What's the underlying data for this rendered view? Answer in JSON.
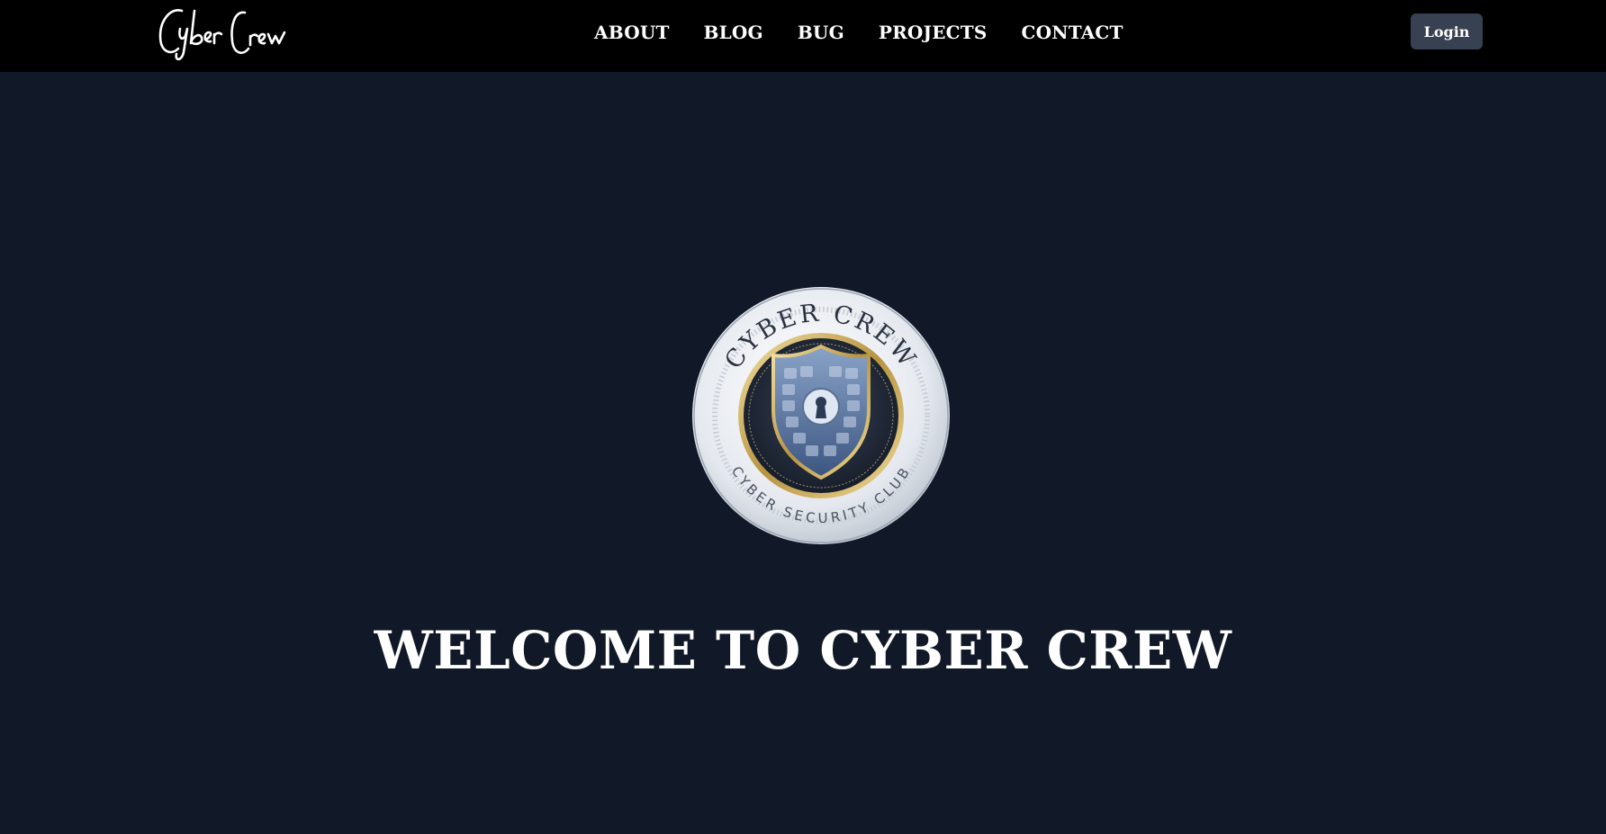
{
  "header": {
    "brand_text": "Cyber Crew",
    "nav": [
      {
        "label": "ABOUT"
      },
      {
        "label": "BLOG"
      },
      {
        "label": "BUG"
      },
      {
        "label": "PROJECTS"
      },
      {
        "label": "CONTACT"
      }
    ],
    "login_label": "Login"
  },
  "hero": {
    "logo": {
      "top_text": "CYBER CREW",
      "bottom_text": "CYBER SECURITY CLUB",
      "icon": "shield-keyhole-icon"
    },
    "title": "WELCOME TO CYBER CREW"
  },
  "colors": {
    "page_bg": "#111827",
    "navbar_bg": "#000000",
    "button_bg": "#374151",
    "text": "#ffffff"
  }
}
